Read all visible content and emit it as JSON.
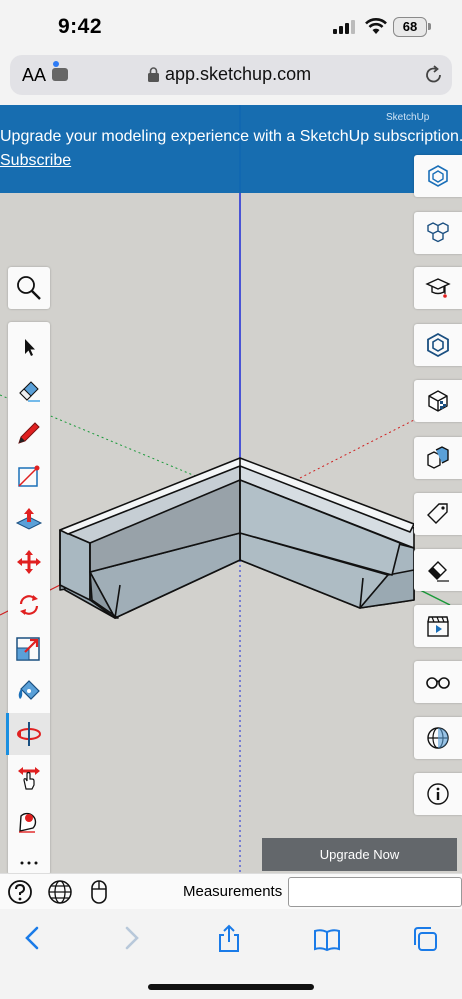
{
  "status_bar": {
    "time": "9:42",
    "battery": "68"
  },
  "browser": {
    "text_size_label": "AA",
    "url": "app.sketchup.com"
  },
  "banner": {
    "message": "Upgrade your modeling experience with a SketchUp subscription.",
    "link": "Subscribe",
    "brand": "SketchUp"
  },
  "upgrade_button": "Upgrade Now",
  "bottom_bar": {
    "measurements_label": "Measurements",
    "measurements_value": ""
  },
  "left_tools": [
    "search-icon",
    "select-arrow-icon",
    "eraser-icon",
    "pencil-icon",
    "rectangle-icon",
    "push-pull-icon",
    "move-icon",
    "rotate-icon",
    "scale-icon",
    "paint-bucket-icon",
    "orbit-icon",
    "pan-icon",
    "tape-measure-icon",
    "more-icon"
  ],
  "right_tools": [
    "instructor-icon",
    "components-icon",
    "3d-warehouse-icon",
    "entity-info-icon",
    "materials-icon",
    "outliner-icon",
    "tags-icon",
    "styles-icon",
    "scenes-icon",
    "display-icon",
    "shadows-icon",
    "model-info-icon"
  ],
  "colors": {
    "banner": "#0f69af",
    "axis_blue": "#1c2ad8",
    "axis_green": "#1a9a3a",
    "axis_red": "#d02020",
    "active_tool": "#1a8fe0"
  }
}
